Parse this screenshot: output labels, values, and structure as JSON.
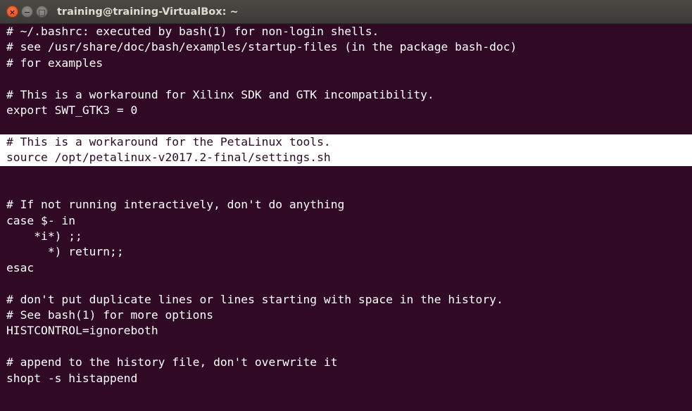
{
  "window": {
    "title": "training@training-VirtualBox: ~",
    "controls": {
      "close_icon": "close-icon",
      "minimize_icon": "minimize-icon",
      "maximize_icon": "maximize-icon"
    }
  },
  "colors": {
    "terminal_bg": "#300a24",
    "terminal_fg": "#ffffff",
    "highlight_bg": "#ffffff",
    "close_button": "#df4a1b"
  },
  "terminal": {
    "lines": [
      {
        "text": "# ~/.bashrc: executed by bash(1) for non-login shells.",
        "highlighted": false
      },
      {
        "text": "# see /usr/share/doc/bash/examples/startup-files (in the package bash-doc)",
        "highlighted": false
      },
      {
        "text": "# for examples",
        "highlighted": false
      },
      {
        "text": "",
        "highlighted": false
      },
      {
        "text": "# This is a workaround for Xilinx SDK and GTK incompatibility.",
        "highlighted": false
      },
      {
        "text": "export SWT_GTK3 = 0",
        "highlighted": false
      },
      {
        "text": "",
        "highlighted": false
      },
      {
        "text": "# This is a workaround for the PetaLinux tools.",
        "highlighted": true
      },
      {
        "text": "source /opt/petalinux-v2017.2-final/settings.sh",
        "highlighted": true
      },
      {
        "text": "",
        "highlighted": false
      },
      {
        "text": "",
        "highlighted": false
      },
      {
        "text": "# If not running interactively, don't do anything",
        "highlighted": false
      },
      {
        "text": "case $- in",
        "highlighted": false
      },
      {
        "text": "    *i*) ;;",
        "highlighted": false
      },
      {
        "text": "      *) return;;",
        "highlighted": false
      },
      {
        "text": "esac",
        "highlighted": false
      },
      {
        "text": "",
        "highlighted": false
      },
      {
        "text": "# don't put duplicate lines or lines starting with space in the history.",
        "highlighted": false
      },
      {
        "text": "# See bash(1) for more options",
        "highlighted": false
      },
      {
        "text": "HISTCONTROL=ignoreboth",
        "highlighted": false
      },
      {
        "text": "",
        "highlighted": false
      },
      {
        "text": "# append to the history file, don't overwrite it",
        "highlighted": false
      },
      {
        "text": "shopt -s histappend",
        "highlighted": false
      }
    ]
  }
}
